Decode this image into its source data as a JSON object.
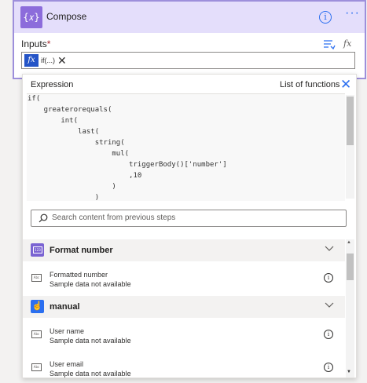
{
  "compose": {
    "title": "Compose",
    "icon": "braces-icon",
    "icon_glyph": "{𝑥}",
    "info_glyph": "i",
    "more_glyph": "···",
    "accent": "#8c6cdb"
  },
  "inputs": {
    "label": "Inputs",
    "required_mark": "*",
    "fx_link": "fx",
    "token_badge": "fx",
    "token_text": "if(...)",
    "token_close": "✕"
  },
  "expression_panel": {
    "label": "Expression",
    "list_functions": "List of functions",
    "close_glyph": "✕",
    "code_lines": [
      "if(",
      "    greaterorequals(",
      "        int(",
      "            last(",
      "                string(",
      "                    mul(",
      "                        triggerBody()['number']",
      "                        ,10",
      "                    )",
      "                )"
    ],
    "search_placeholder": "Search content from previous steps"
  },
  "groups": [
    {
      "title": "Format number",
      "icon": "number-format-icon",
      "icon_glyph": "123",
      "color": "#7a63d2",
      "items": [
        {
          "title": "Formatted number",
          "subtitle": "Sample data not available"
        }
      ]
    },
    {
      "title": "manual",
      "icon": "manual-trigger-icon",
      "icon_glyph": "☝",
      "color": "#2b6ff0",
      "items": [
        {
          "title": "User name",
          "subtitle": "Sample data not available"
        },
        {
          "title": "User email",
          "subtitle": "Sample data not available"
        }
      ]
    }
  ],
  "item_icon_glyph": "Abc",
  "item_info_glyph": "i"
}
